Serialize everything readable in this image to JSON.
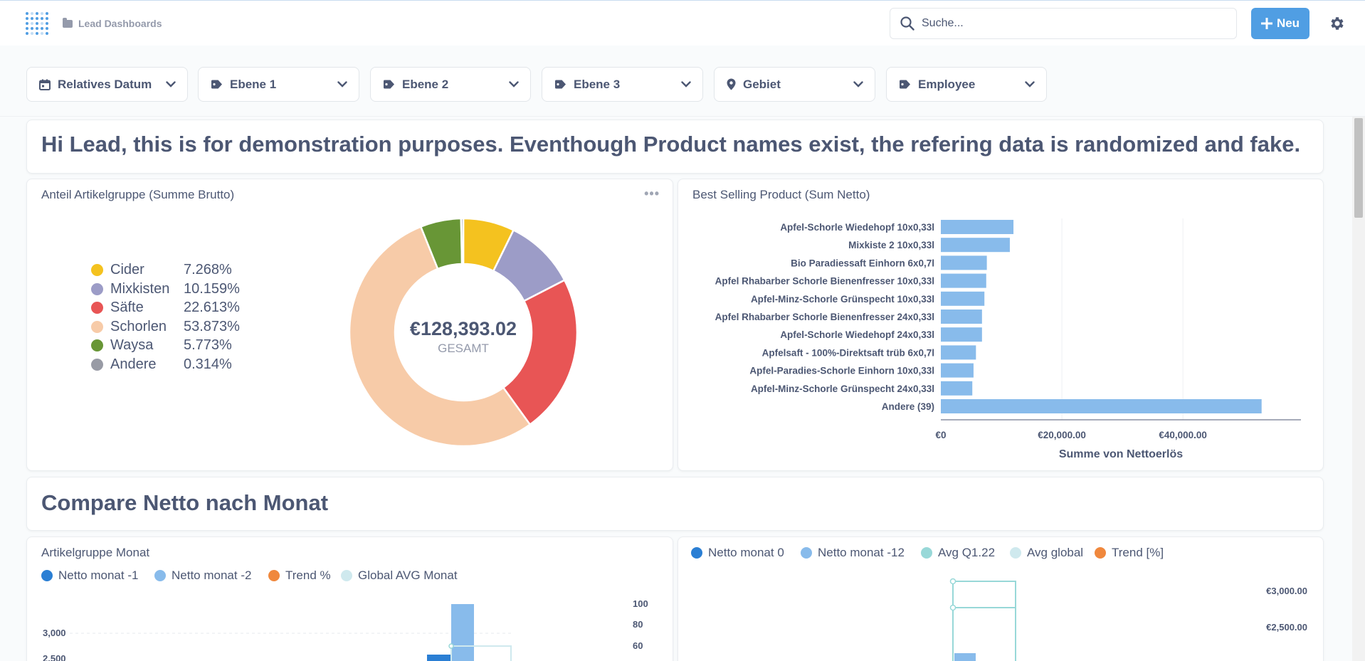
{
  "nav": {
    "breadcrumb": "Lead Dashboards",
    "search_placeholder": "Suche...",
    "new_label": "Neu"
  },
  "filters": [
    {
      "label": "Relatives Datum",
      "icon": "calendar-icon"
    },
    {
      "label": "Ebene 1",
      "icon": "tag-icon"
    },
    {
      "label": "Ebene 2",
      "icon": "tag-icon"
    },
    {
      "label": "Ebene 3",
      "icon": "tag-icon"
    },
    {
      "label": "Gebiet",
      "icon": "location-pin-icon"
    },
    {
      "label": "Employee",
      "icon": "tag-icon"
    }
  ],
  "banner": {
    "text": "Hi Lead, this is for demonstration purposes. Eventhough Product names exist, the refering data is randomized and fake."
  },
  "pie_card": {
    "title": "Anteil Artikelgruppe (Summe Brutto)",
    "total_value": "€128,393.02",
    "total_label": "GESAMT",
    "legend": [
      {
        "label": "Cider",
        "pct": "7.268%",
        "color": "#f4c21f"
      },
      {
        "label": "Mixkisten",
        "pct": "10.159%",
        "color": "#9c9cc7"
      },
      {
        "label": "Säfte",
        "pct": "22.613%",
        "color": "#e85555"
      },
      {
        "label": "Schorlen",
        "pct": "53.873%",
        "color": "#f7cba8"
      },
      {
        "label": "Waysa",
        "pct": "5.773%",
        "color": "#689636"
      },
      {
        "label": "Andere",
        "pct": "0.314%",
        "color": "#989ba5"
      }
    ]
  },
  "bar_card": {
    "title": "Best Selling Product (Sum Netto)",
    "xlabel": "Summe von Nettoerlös",
    "ticks": [
      "€0",
      "€20,000.00",
      "€40,000.00"
    ]
  },
  "section2": {
    "heading": "Compare Netto nach Monat"
  },
  "monthly_card": {
    "title": "Artikelgruppe Monat",
    "legend": [
      {
        "label": "Netto monat -1",
        "color": "#2b7fd4"
      },
      {
        "label": "Netto monat -2",
        "color": "#88bbeb"
      },
      {
        "label": "Trend %",
        "color": "#f0883d"
      },
      {
        "label": "Global AVG Monat",
        "color": "#cfe9ee"
      }
    ],
    "y_left_ticks": [
      "3,000",
      "2,500"
    ],
    "y_right_ticks": [
      "100",
      "80",
      "60"
    ]
  },
  "compare_card": {
    "legend": [
      {
        "label": "Netto monat 0",
        "color": "#2b7fd4"
      },
      {
        "label": "Netto monat -12",
        "color": "#88bbeb"
      },
      {
        "label": "Avg Q1.22",
        "color": "#98d8d8"
      },
      {
        "label": "Avg global",
        "color": "#cfe9ee"
      },
      {
        "label": "Trend [%]",
        "color": "#f0883d"
      }
    ],
    "y_ticks": [
      "€3,000.00",
      "€2,500.00"
    ]
  },
  "chart_data": [
    {
      "type": "pie",
      "title": "Anteil Artikelgruppe (Summe Brutto)",
      "categories": [
        "Cider",
        "Mixkisten",
        "Säfte",
        "Schorlen",
        "Waysa",
        "Andere"
      ],
      "values": [
        7.268,
        10.159,
        22.613,
        53.873,
        5.773,
        0.314
      ],
      "colors": [
        "#f4c21f",
        "#9c9cc7",
        "#e85555",
        "#f7cba8",
        "#689636",
        "#989ba5"
      ],
      "total": "€128,393.02",
      "legend_position": "left",
      "donut": true
    },
    {
      "type": "bar",
      "orientation": "horizontal",
      "title": "Best Selling Product (Sum Netto)",
      "categories": [
        "Apfel-Schorle Wiedehopf 10x0,33l",
        "Mixkiste 2 10x0,33l",
        "Bio Paradiessaft Einhorn 6x0,7l",
        "Apfel Rhabarber Schorle Bienenfresser 10x0,33l",
        "Apfel-Minz-Schorle Grünspecht 10x0,33l",
        "Apfel Rhabarber Schorle Bienenfresser 24x0,33l",
        "Apfel-Schorle Wiedehopf 24x0,33l",
        "Apfelsaft - 100%-Direktsaft trüb 6x0,7l",
        "Apfel-Paradies-Schorle Einhorn 10x0,33l",
        "Apfel-Minz-Schorle Grünspecht 24x0,33l",
        "Andere (39)"
      ],
      "values": [
        12000,
        11400,
        7600,
        7500,
        7200,
        6800,
        6800,
        5800,
        5400,
        5200,
        53000
      ],
      "xlabel": "Summe von Nettoerlös",
      "ylabel": "",
      "xlim": [
        0,
        59500
      ],
      "grid": true,
      "color": "#88bbeb"
    }
  ]
}
